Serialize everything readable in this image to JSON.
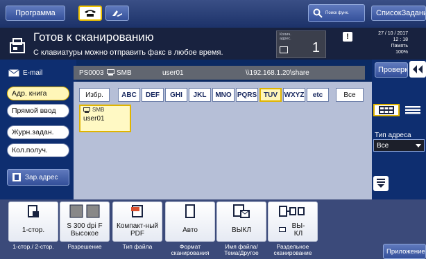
{
  "topbar": {
    "program_label": "Программа",
    "search_label": "Поиск функ.",
    "list_label": "СписокЗаданий"
  },
  "status": {
    "title": "Готов к сканированию",
    "subtitle": "С клавиатуры можно отправить факс в любое время.",
    "counter_label": "Колич. адрес.",
    "counter_value": "1",
    "date": "27 / 10 / 2017",
    "time": "12 : 18",
    "memory_label": "Память",
    "memory_value": "100%"
  },
  "sidebar": {
    "email_tab": "E-mail",
    "items": [
      {
        "label": "Адр. книга"
      },
      {
        "label": "Прямой ввод"
      },
      {
        "label": "Журн.задан."
      },
      {
        "label": "Кол.получ."
      }
    ],
    "register_label": "Зар.адрес"
  },
  "destination": {
    "id": "PS0003",
    "type": "SMB",
    "user": "user01",
    "path": "\\\\192.168.1.20\\share"
  },
  "filters": [
    "Избр.",
    "ABC",
    "DEF",
    "GHI",
    "JKL",
    "MNO",
    "PQRS",
    "TUV",
    "WXYZ",
    "etc",
    "Все"
  ],
  "entry": {
    "type": "SMB",
    "name": "user01"
  },
  "right": {
    "check_label": "Проверка",
    "addr_type_label": "Тип адреса",
    "addr_type_value": "Все"
  },
  "tools": [
    {
      "value": "1-стор.",
      "caption": "1-стор./ 2-стор."
    },
    {
      "value": "S 300 dpi F Высокое",
      "caption": "Разрешение"
    },
    {
      "value": "Компакт-ный PDF",
      "caption": "Тип файла"
    },
    {
      "value": "Авто",
      "caption": "Формат сканирования"
    },
    {
      "value": "ВЫКЛ",
      "caption": "Имя файла/ Тема/Другое"
    },
    {
      "value": "ВЫ- КЛ",
      "caption": "Раздельное сканирование"
    }
  ],
  "apps_label": "Приложение",
  "colors": {
    "highlight": "#e0b400",
    "panel": "#b6bfd7",
    "navy": "#0e2e70"
  }
}
